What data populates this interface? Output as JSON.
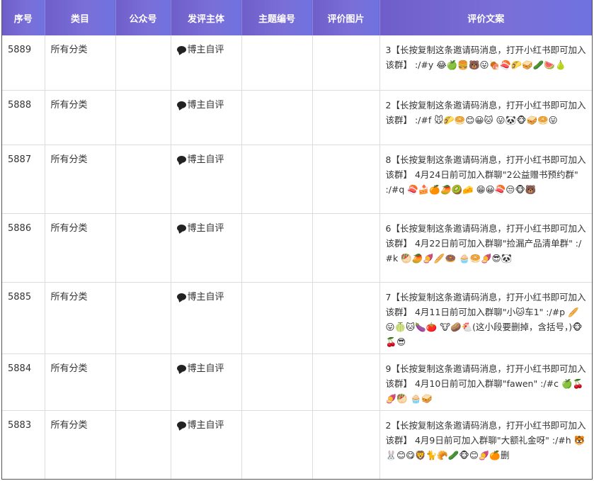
{
  "header": {
    "columns": [
      "序号",
      "类目",
      "公众号",
      "发评主体",
      "主题编号",
      "评价图片",
      "评价文案"
    ]
  },
  "rows": [
    {
      "id": "5889",
      "category": "所有分类",
      "account": "",
      "subject": "博主自评",
      "topic": "",
      "image": "",
      "text": "3【长按复制这条邀请码消息，打开小红书即可加入该群】 :/#y 😂🍏🍔🐻😛🍖🍣🌮🥪🥒🍉🍐"
    },
    {
      "id": "5888",
      "category": "所有分类",
      "account": "",
      "subject": "博主自评",
      "topic": "",
      "image": "",
      "text": "2【长按复制这条邀请码消息，打开小红书即可加入该群】 :/#f 🐭🌮🥯😊😀🐱 😛🐼🐵🥪🥯😛"
    },
    {
      "id": "5887",
      "category": "所有分类",
      "account": "",
      "subject": "博主自评",
      "topic": "",
      "image": "",
      "text": "8【长按复制这条邀请码消息，打开小红书即可加入该群】 4月24日前可加入群聊\"2公益赠书预约群\" :/#q 🍣🍰🍊🥭🥝🧀 😁😀🍣😒🐵🐻"
    },
    {
      "id": "5886",
      "category": "所有分类",
      "account": "",
      "subject": "博主自评",
      "topic": "",
      "image": "",
      "text": "6【长按复制这条邀请码消息，打开小红书即可加入该群】 4月22日前可加入群聊\"捡漏产品清单群\" :/#k 🥙🥭🍠🥖🍩 🧁🥯🍠😎🐼"
    },
    {
      "id": "5885",
      "category": "所有分类",
      "account": "",
      "subject": "博主自评",
      "topic": "",
      "image": "",
      "text": "7【长按复制这条邀请码消息，打开小红书即可加入该群】 4月11日前可加入群聊\"小🐱车1\" :/#p 🥖😛🍈🐱🍆🍅 🐮🥔🐔(这小段要删掉，含括号，)🐵🍒😎"
    },
    {
      "id": "5884",
      "category": "所有分类",
      "account": "",
      "subject": "博主自评",
      "topic": "",
      "image": "",
      "text": "9【长按复制这条邀请码消息，打开小红书即可加入该群】 4月10日前可加入群聊\"fawen\" :/#c 🍏🍒🍠🥙 🧁🥪"
    },
    {
      "id": "5883",
      "category": "所有分类",
      "account": "",
      "subject": "博主自评",
      "topic": "",
      "image": "",
      "text": "2【长按复制这条邀请码消息，打开小红书即可加入该群】 4月9日前可加入群聊\"大额礼金呀\" :/#h 🐯🐰😊😋🦁🐈🥐🥒🐵😊🍠🍊删"
    }
  ]
}
